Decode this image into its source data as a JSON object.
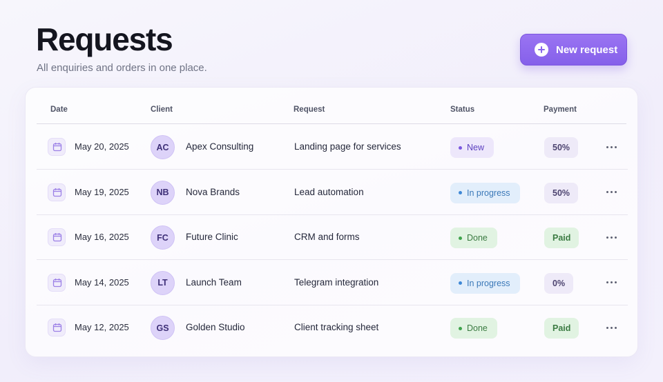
{
  "header": {
    "title": "Requests",
    "subtitle": "All enquiries and orders in one place.",
    "new_button": {
      "label": "New request",
      "icon": "plus-circle-icon"
    }
  },
  "table": {
    "columns": [
      "Date",
      "Client",
      "Request",
      "Status",
      "Payment"
    ],
    "rows": [
      {
        "date": "May 20, 2025",
        "initials": "AC",
        "client": "Apex Consulting",
        "request": "Landing page for services",
        "status": "New",
        "status_kind": "new",
        "payment": "50%",
        "payment_kind": "partial"
      },
      {
        "date": "May 19, 2025",
        "initials": "NB",
        "client": "Nova Brands",
        "request": "Lead automation",
        "status": "In progress",
        "status_kind": "progress",
        "payment": "50%",
        "payment_kind": "partial"
      },
      {
        "date": "May 16, 2025",
        "initials": "FC",
        "client": "Future Clinic",
        "request": "CRM and forms",
        "status": "Done",
        "status_kind": "done",
        "payment": "Paid",
        "payment_kind": "paid"
      },
      {
        "date": "May 14, 2025",
        "initials": "LT",
        "client": "Launch Team",
        "request": "Telegram integration",
        "status": "In progress",
        "status_kind": "progress",
        "payment": "0%",
        "payment_kind": "partial"
      },
      {
        "date": "May 12, 2025",
        "initials": "GS",
        "client": "Golden Studio",
        "request": "Client tracking sheet",
        "status": "Done",
        "status_kind": "done",
        "payment": "Paid",
        "payment_kind": "paid"
      }
    ]
  },
  "colors": {
    "accent": "#8a65eb",
    "status_new_bg": "#ede7fb",
    "status_new_fg": "#5b3fc0",
    "status_new_dot": "#7b58e0",
    "status_progress_bg": "#e2eefb",
    "status_progress_fg": "#3a78b8",
    "status_progress_dot": "#3f88d6",
    "status_done_bg": "#e1f3e2",
    "status_done_fg": "#3b7b42",
    "status_done_dot": "#3fa34c",
    "pay_partial_bg": "#eeeaf8",
    "pay_partial_fg": "#4d4470",
    "pay_paid_bg": "#e1f3e2",
    "pay_paid_fg": "#3b7b42"
  }
}
